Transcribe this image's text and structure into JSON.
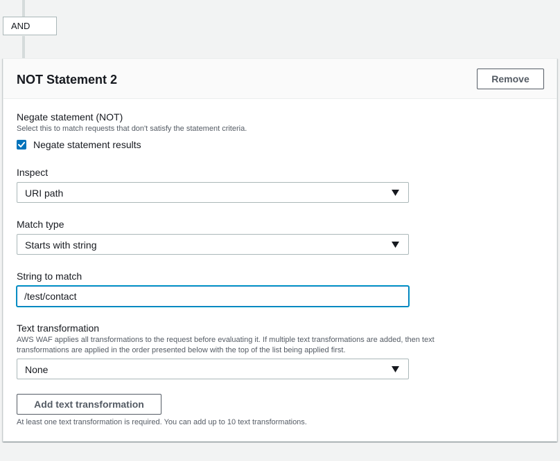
{
  "connector": {
    "operator_label": "AND"
  },
  "panel": {
    "title": "NOT Statement 2",
    "remove_label": "Remove"
  },
  "negate": {
    "label": "Negate statement (NOT)",
    "description": "Select this to match requests that don't satisfy the statement criteria.",
    "checkbox_label": "Negate statement results",
    "checked": true
  },
  "inspect": {
    "label": "Inspect",
    "selected": "URI path"
  },
  "match_type": {
    "label": "Match type",
    "selected": "Starts with string"
  },
  "string_to_match": {
    "label": "String to match",
    "value": "/test/contact"
  },
  "text_transformation": {
    "label": "Text transformation",
    "description_line1": "AWS WAF applies all transformations to the request before evaluating it. If multiple text transformations are added, then text",
    "description_line2": "transformations are applied in the order presented below with the top of the list being applied first.",
    "selected": "None",
    "add_label": "Add text transformation",
    "hint": "At least one text transformation is required. You can add up to 10 text transformations."
  },
  "colors": {
    "accent": "#0073bb",
    "focus_ring": "#00a1c9",
    "text": "#16191f",
    "secondary_text": "#545b64",
    "border": "#aab7b8",
    "background": "#f2f3f3"
  },
  "icons": {
    "checkbox": "check-icon",
    "dropdown": "caret-down-icon"
  }
}
